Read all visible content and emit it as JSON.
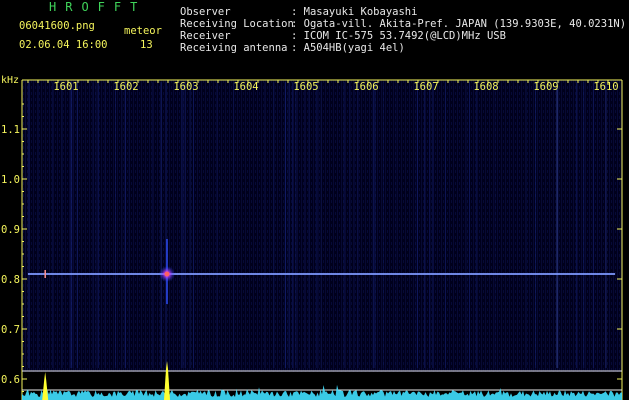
{
  "header": {
    "app_title": "HROFFT",
    "filename": "06041600.png",
    "timestamp": "02.06.04 16:00",
    "meteor_label": "meteor",
    "meteor_count": "13",
    "info_labels": [
      "Observer",
      "Receiving Location",
      "Receiver",
      "Receiving antenna"
    ],
    "info_values": [
      ": Masayuki Kobayashi",
      ": Ogata-vill. Akita-Pref. JAPAN (139.9303E, 40.0231N)",
      ": ICOM IC-575 53.7492(@LCD)MHz USB",
      ": A504HB(yagi 4el)"
    ]
  },
  "chart_data": {
    "type": "heatmap",
    "xlabel": "",
    "ylabel": "kHz",
    "x_ticks": [
      "1601",
      "1602",
      "1603",
      "1604",
      "1605",
      "1606",
      "1607",
      "1608",
      "1609",
      "1610"
    ],
    "y_ticks": [
      "1.1",
      "1.0",
      "0.9",
      "0.8",
      "0.7",
      "0.6"
    ],
    "ylim": [
      0.58,
      1.17
    ],
    "carrier_khz": 0.81,
    "meteor_echoes": [
      {
        "time_min": 1602.65,
        "khz": 0.81,
        "strength": "strong"
      },
      {
        "time_min": 1600.62,
        "khz": 0.81,
        "strength": "weak"
      }
    ],
    "colors": {
      "background": "#000018",
      "carrier": "#6e8cff",
      "echo_core": "#ff6060",
      "spectrum": "#40e0ff",
      "peak": "#ffff30",
      "axis_text": "#f4f45c"
    }
  }
}
